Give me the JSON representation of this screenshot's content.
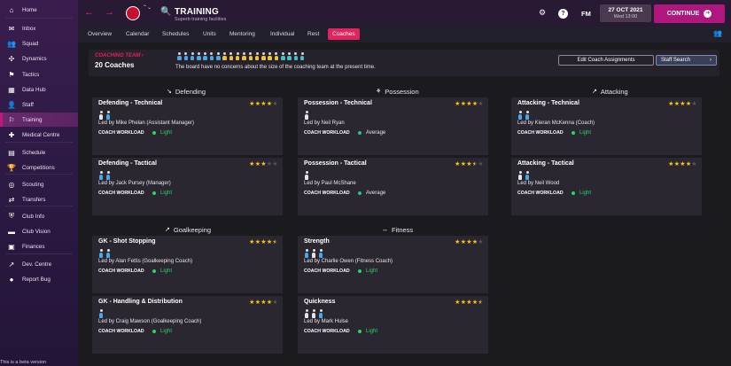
{
  "sidebar": {
    "items": [
      {
        "label": "Home",
        "icon": "home-icon",
        "glyph": "⌂"
      },
      {
        "label": "Inbox",
        "icon": "inbox-icon",
        "glyph": "✉"
      },
      {
        "label": "Squad",
        "icon": "squad-icon",
        "glyph": "👥"
      },
      {
        "label": "Dynamics",
        "icon": "dynamics-icon",
        "glyph": "✣"
      },
      {
        "label": "Tactics",
        "icon": "tactics-icon",
        "glyph": "⚑"
      },
      {
        "label": "Data Hub",
        "icon": "data-hub-icon",
        "glyph": "▦"
      },
      {
        "label": "Staff",
        "icon": "staff-icon",
        "glyph": "👤"
      },
      {
        "label": "Training",
        "icon": "training-icon",
        "glyph": "⚐"
      },
      {
        "label": "Medical Centre",
        "icon": "medical-icon",
        "glyph": "✚"
      },
      {
        "label": "Schedule",
        "icon": "schedule-icon",
        "glyph": "▤"
      },
      {
        "label": "Competitions",
        "icon": "competitions-icon",
        "glyph": "🏆"
      },
      {
        "label": "Scouting",
        "icon": "scouting-icon",
        "glyph": "◎"
      },
      {
        "label": "Transfers",
        "icon": "transfers-icon",
        "glyph": "⇄"
      },
      {
        "label": "Club Info",
        "icon": "club-info-icon",
        "glyph": "⛨"
      },
      {
        "label": "Club Vision",
        "icon": "club-vision-icon",
        "glyph": "▬"
      },
      {
        "label": "Finances",
        "icon": "finances-icon",
        "glyph": "▣"
      },
      {
        "label": "Dev. Centre",
        "icon": "dev-centre-icon",
        "glyph": "↗"
      },
      {
        "label": "Report Bug",
        "icon": "report-bug-icon",
        "glyph": "●"
      }
    ],
    "beta_text": "This is a beta version"
  },
  "header": {
    "title": "TRAINING",
    "subtitle": "Superb training facilities",
    "back_icon": "←",
    "forward_icon": "→",
    "club_chevron": "⌃⌄",
    "search_icon": "🔍",
    "fm_label": "FM",
    "help_icon": "?",
    "settings_icon": "⚙",
    "date": "27 OCT 2021",
    "date_sub": "Wed 13:00",
    "continue_label": "CONTINUE",
    "continue_icon": "➜"
  },
  "tabs": [
    "Overview",
    "Calendar",
    "Schedules",
    "Units",
    "Mentoring",
    "Individual",
    "Rest",
    "Coaches"
  ],
  "active_tab": "Coaches",
  "coaching_team": {
    "label": "COACHING TEAM ›",
    "count": "20 Coaches",
    "message": "The board have no concerns about the size of the coaching team at the present time.",
    "edit_button": "Edit Coach Assignments",
    "search_button": "Staff Search",
    "search_chevron": "›",
    "coach_icon_colors": [
      "blue",
      "blue",
      "blue",
      "blue",
      "blue",
      "blue",
      "blue",
      "yellow",
      "yellow",
      "yellow",
      "yellow",
      "yellow",
      "yellow",
      "yellow",
      "yellow",
      "yellow",
      "teal",
      "teal",
      "teal",
      "teal"
    ]
  },
  "sections": {
    "defending": {
      "label": "Defending",
      "icon": "↘"
    },
    "possession": {
      "label": "Possession",
      "icon": "⚘"
    },
    "attacking": {
      "label": "Attacking",
      "icon": "↗"
    },
    "goalkeeping": {
      "label": "Goalkeeping",
      "icon": "↗"
    },
    "fitness": {
      "label": "Fitness",
      "icon": "↔"
    }
  },
  "workload_label": "COACH WORKLOAD",
  "colors": {
    "light": "#2ad46a",
    "average": "#2ac08a",
    "accent": "#e0245e",
    "star": "#f5c518"
  },
  "cards": {
    "def_tech": {
      "title": "Defending - Technical",
      "stars": 4,
      "coaches": [
        "white",
        "blue"
      ],
      "led_by": "Led by Mike Phelan (Assistant Manager)",
      "workload": "Light"
    },
    "def_tact": {
      "title": "Defending - Tactical",
      "stars": 3,
      "coaches": [
        "blue",
        "blue"
      ],
      "led_by": "Led by Jack Pursey (Manager)",
      "workload": "Light"
    },
    "pos_tech": {
      "title": "Possession - Technical",
      "stars": 4,
      "coaches": [
        "white"
      ],
      "led_by": "Led by Neil Ryan",
      "workload": "Average"
    },
    "pos_tact": {
      "title": "Possession - Tactical",
      "stars": 3.5,
      "coaches": [
        "white"
      ],
      "led_by": "Led by Paul McShane",
      "workload": "Average"
    },
    "att_tech": {
      "title": "Attacking - Technical",
      "stars": 4,
      "coaches": [
        "blue",
        "blue"
      ],
      "led_by": "Led by Kieran McKenna (Coach)",
      "workload": "Light"
    },
    "att_tact": {
      "title": "Attacking - Tactical",
      "stars": 4,
      "coaches": [
        "white",
        "blue"
      ],
      "led_by": "Led by Neil Wood",
      "workload": "Light"
    },
    "gk_shot": {
      "title": "GK - Shot Stopping",
      "stars": 4.5,
      "coaches": [
        "blue",
        "blue"
      ],
      "led_by": "Led by Alan Fettis (Goalkeeping Coach)",
      "workload": "Light"
    },
    "gk_hand": {
      "title": "GK - Handling & Distribution",
      "stars": 4,
      "coaches": [
        "blue"
      ],
      "led_by": "Led by Craig Mawson (Goalkeeping Coach)",
      "workload": "Light"
    },
    "strength": {
      "title": "Strength",
      "stars": 4,
      "coaches": [
        "blue",
        "white",
        "blue"
      ],
      "led_by": "Led by Charlie Owen (Fitness Coach)",
      "workload": "Light"
    },
    "quickness": {
      "title": "Quickness",
      "stars": 4.5,
      "coaches": [
        "white",
        "white",
        "blue"
      ],
      "led_by": "Led by Mark Hulse",
      "workload": "Light"
    }
  }
}
